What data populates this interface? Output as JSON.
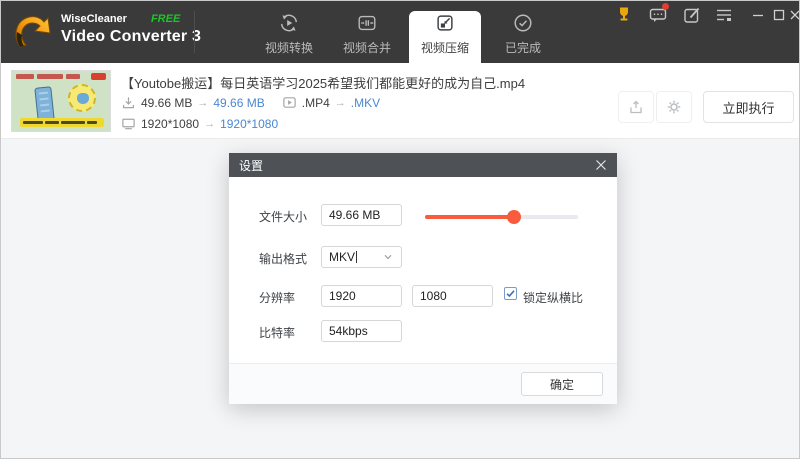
{
  "brand": {
    "company": "WiseCleaner",
    "badge": "FREE",
    "product": "Video Converter 3"
  },
  "tabs": [
    {
      "label": "视频转换"
    },
    {
      "label": "视频合并"
    },
    {
      "label": "视频压缩",
      "active": true
    },
    {
      "label": "已完成"
    }
  ],
  "file": {
    "title": "【Youtobe搬运】每日英语学习2025希望我们都能更好的成为自己.mp4",
    "size_from": "49.66 MB",
    "size_to": "49.66 MB",
    "format_from": ".MP4",
    "format_to": ".MKV",
    "resolution_from": "1920*1080",
    "resolution_to": "1920*1080",
    "arrow": "→",
    "execute_label": "立即执行"
  },
  "dialog": {
    "title": "设置",
    "file_size_label": "文件大小",
    "file_size_value": "49.66 MB",
    "slider_percent": 58,
    "output_format_label": "输出格式",
    "output_format_value": "MKV",
    "resolution_label": "分辨率",
    "resolution_width": "1920",
    "resolution_height": "1080",
    "lock_aspect_label": "锁定纵横比",
    "lock_aspect_checked": true,
    "bitrate_label": "比特率",
    "bitrate_value": "54kbps",
    "ok_label": "确定"
  },
  "icons": {
    "trophy": "🏆",
    "message": "💬",
    "edit": "📝",
    "menu-list": "≡",
    "minimize": "—",
    "maximize": "□",
    "close": "✕",
    "convert": "circular-arrows-play",
    "merge": "arrows-to-center",
    "compress": "arrow-into-box",
    "done": "check-circle",
    "download": "↓",
    "play": "▶",
    "monitor": "🖵",
    "save": "archive-up",
    "gear": "⚙",
    "chevron-down": "⌄",
    "check": "✓"
  },
  "colors": {
    "topbar": "#3a3a3b",
    "accent_red": "#f95b3d",
    "link_blue": "#4a87d0",
    "badge_green": "#1fc32a",
    "dialog_header": "#4e5156"
  }
}
